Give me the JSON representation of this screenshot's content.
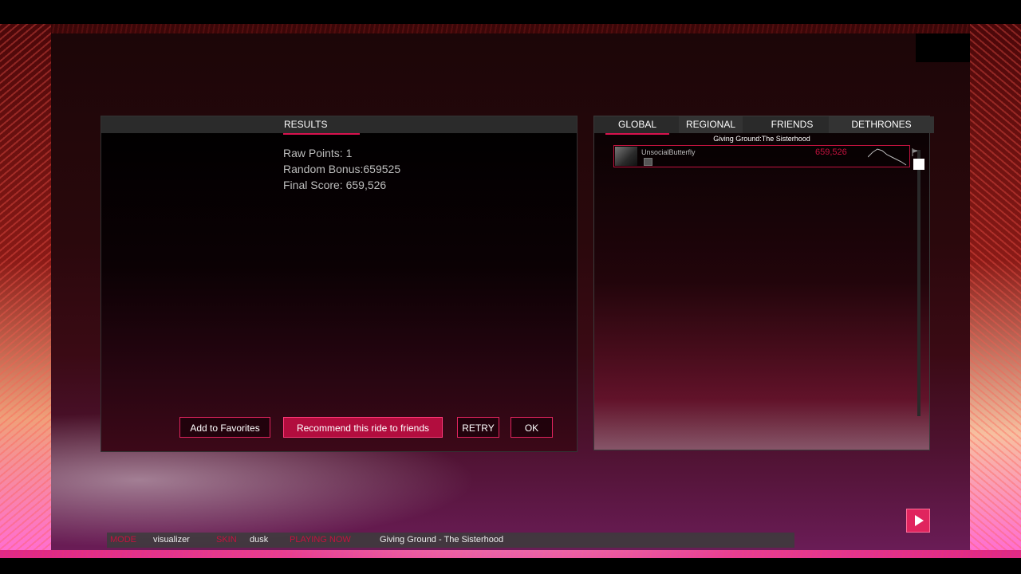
{
  "results": {
    "tab_label": "RESULTS",
    "raw_points": "Raw Points: 1",
    "random_bonus": "Random Bonus:659525",
    "final_score": "Final Score: 659,526",
    "buttons": {
      "favorites": "Add to Favorites",
      "recommend": "Recommend this ride to friends",
      "retry": "RETRY",
      "ok": "OK"
    }
  },
  "leaderboard": {
    "tabs": [
      "GLOBAL",
      "REGIONAL",
      "FRIENDS",
      "DETHRONES"
    ],
    "active_tab": "GLOBAL",
    "song_title": "Giving Ground:The Sisterhood",
    "entries": [
      {
        "player": "UnsocialButterfly",
        "score": "659,526"
      }
    ]
  },
  "status": {
    "mode_label": "MODE",
    "mode_value": "visualizer",
    "skin_label": "SKIN",
    "skin_value": "dusk",
    "playing_label": "PLAYING NOW",
    "playing_value": "Giving Ground - The Sisterhood"
  },
  "colors": {
    "accent": "#e0245e",
    "accent_dark": "#b20d3e",
    "label_red": "#c4123e"
  },
  "icons": {
    "play": "play-icon",
    "flag": "flag-icon"
  }
}
